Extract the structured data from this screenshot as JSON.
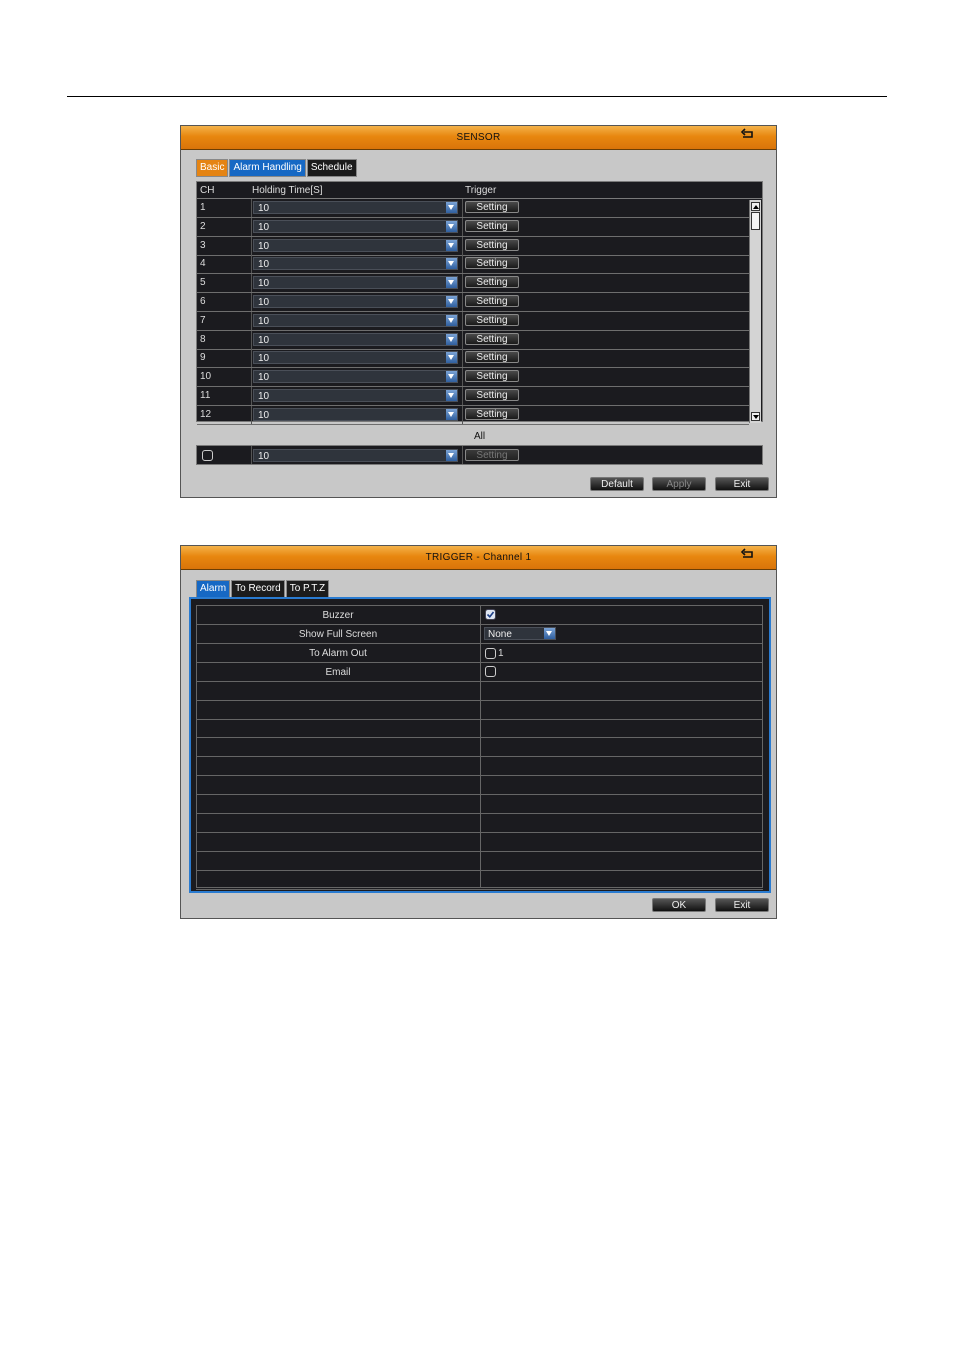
{
  "sensor": {
    "title": "SENSOR",
    "tabs": [
      {
        "label": "Basic",
        "state": "orange"
      },
      {
        "label": "Alarm Handling",
        "state": "blue"
      },
      {
        "label": "Schedule",
        "state": "normal"
      }
    ],
    "headers": {
      "ch": "CH",
      "holding": "Holding Time[S]",
      "trigger": "Trigger"
    },
    "rows": [
      {
        "ch": "1",
        "holding": "10",
        "trigger": "Setting"
      },
      {
        "ch": "2",
        "holding": "10",
        "trigger": "Setting"
      },
      {
        "ch": "3",
        "holding": "10",
        "trigger": "Setting"
      },
      {
        "ch": "4",
        "holding": "10",
        "trigger": "Setting"
      },
      {
        "ch": "5",
        "holding": "10",
        "trigger": "Setting"
      },
      {
        "ch": "6",
        "holding": "10",
        "trigger": "Setting"
      },
      {
        "ch": "7",
        "holding": "10",
        "trigger": "Setting"
      },
      {
        "ch": "8",
        "holding": "10",
        "trigger": "Setting"
      },
      {
        "ch": "9",
        "holding": "10",
        "trigger": "Setting"
      },
      {
        "ch": "10",
        "holding": "10",
        "trigger": "Setting"
      },
      {
        "ch": "11",
        "holding": "10",
        "trigger": "Setting"
      },
      {
        "ch": "12",
        "holding": "10",
        "trigger": "Setting"
      }
    ],
    "all_label": "All",
    "all_row": {
      "holding": "10",
      "trigger": "Setting"
    },
    "buttons": {
      "default": "Default",
      "apply": "Apply",
      "exit": "Exit"
    }
  },
  "trigger": {
    "title": "TRIGGER - Channel 1",
    "tabs": [
      {
        "label": "Alarm",
        "state": "blue"
      },
      {
        "label": "To Record",
        "state": "normal"
      },
      {
        "label": "To P.T.Z",
        "state": "normal"
      }
    ],
    "rows": {
      "buzzer": {
        "label": "Buzzer",
        "checked": true
      },
      "full_screen": {
        "label": "Show Full Screen",
        "value": "None"
      },
      "alarm_out": {
        "label": "To Alarm Out",
        "option": "1",
        "checked": false
      },
      "email": {
        "label": "Email",
        "checked": false
      }
    },
    "buttons": {
      "ok": "OK",
      "exit": "Exit"
    }
  },
  "icons": {
    "back": "back-arrow-icon",
    "dropdown": "dropdown-arrow-icon"
  }
}
